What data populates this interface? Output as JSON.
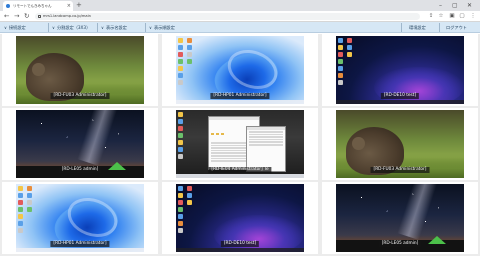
{
  "browser": {
    "tab_title": "リモートでんきみちゃん",
    "url": "mrs1.landcomp.co.jp/main",
    "new_tab": "+",
    "window_controls": {
      "minimize": "–",
      "restore": "▢",
      "close": "✕"
    }
  },
  "toolbar": {
    "items": [
      {
        "label": "接続設定"
      },
      {
        "label": "分割設定（3X3）"
      },
      {
        "label": "表示名設定"
      },
      {
        "label": "表示順設定"
      }
    ],
    "right": [
      {
        "label": "環境設定"
      },
      {
        "label": "ログアウト"
      }
    ]
  },
  "grid": {
    "cells": [
      {
        "caption": "[RD-FU03 Administrator]",
        "wallpaper": "marmot"
      },
      {
        "caption": "[RD-HP01 Administrator]",
        "wallpaper": "bloom"
      },
      {
        "caption": "[RD-DE10 test]",
        "wallpaper": "dark"
      },
      {
        "caption": "[RD-LE05 admin]",
        "wallpaper": "milky"
      },
      {
        "caption": "[RD-IE04 Administrator] Te",
        "wallpaper": "mixed"
      },
      {
        "caption": "[RD-FU03 Administrator]",
        "wallpaper": "marmot"
      },
      {
        "caption": "[RD-HP01 Administrator]",
        "wallpaper": "bloom"
      },
      {
        "caption": "[RD-DE10 test]",
        "wallpaper": "dark"
      },
      {
        "caption": "[RD-LE05 admin]",
        "wallpaper": "milky"
      }
    ]
  },
  "colors": {
    "toolbar_bg": "#d6e7f5",
    "grid_bg": "#ececec",
    "caption_bg": "#141414"
  }
}
